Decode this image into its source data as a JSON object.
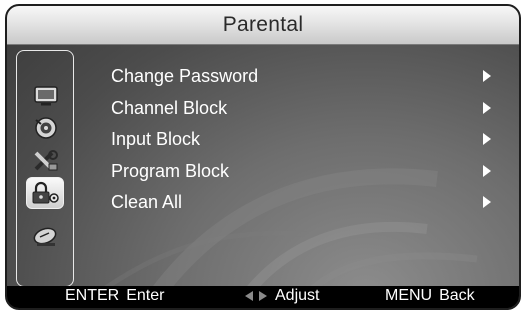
{
  "menu": {
    "title": "Parental",
    "items": [
      {
        "label": "Change Password"
      },
      {
        "label": "Channel Block"
      },
      {
        "label": "Input Block"
      },
      {
        "label": "Program Block"
      },
      {
        "label": "Clean All"
      }
    ]
  },
  "sidebar": {
    "icons": [
      {
        "icon": "tv-picture-icon",
        "selected": false
      },
      {
        "icon": "sound-speaker-icon",
        "selected": false
      },
      {
        "icon": "setup-tools-icon",
        "selected": false
      },
      {
        "icon": "parental-lock-icon",
        "selected": true
      },
      {
        "icon": "satellite-dish-icon",
        "selected": false
      }
    ]
  },
  "footer": {
    "enter_key": "ENTER",
    "enter_label": "Enter",
    "adjust_icon": "left-right-arrows-icon",
    "adjust_label": "Adjust",
    "menu_key": "MENU",
    "menu_label": "Back"
  },
  "colors": {
    "title_bar": "#e4e4e4",
    "panel_background": "#5a5a5a",
    "text": "#ffffff",
    "footer_background": "#000000"
  }
}
